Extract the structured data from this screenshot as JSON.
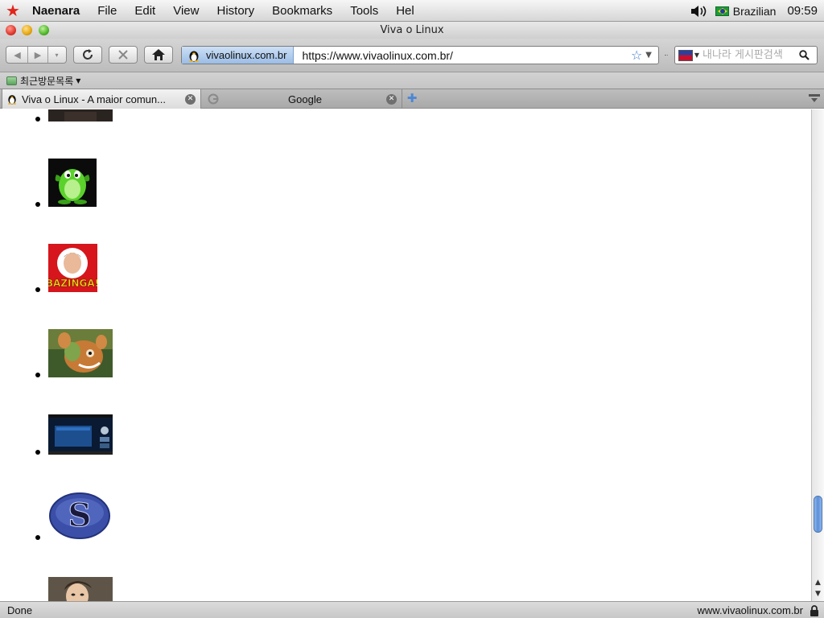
{
  "menubar": {
    "app_name": "Naenara",
    "items": [
      "File",
      "Edit",
      "View",
      "History",
      "Bookmarks",
      "Tools",
      "Hel"
    ],
    "input_language": "Brazilian",
    "clock": "09:59"
  },
  "window": {
    "title": "Viva o Linux"
  },
  "navbar": {
    "site_identity": "vivaolinux.com.br",
    "url": "https://www.vivaolinux.com.br/",
    "search_placeholder": "내나라 게시판검색"
  },
  "bookmarks": {
    "items": [
      {
        "label": "최근방문목록"
      }
    ]
  },
  "tabs": [
    {
      "label": "Viva o Linux - A maior comun...",
      "active": true
    },
    {
      "label": "Google",
      "active": false
    }
  ],
  "content": {
    "avatars": [
      {
        "icon": "dark-avatar"
      },
      {
        "icon": "green-tux-avatar"
      },
      {
        "icon": "bazinga-avatar",
        "text": "BAZINGA!"
      },
      {
        "icon": "cartoon-creature-avatar"
      },
      {
        "icon": "desktop-screenshot-avatar"
      },
      {
        "icon": "slackware-s-avatar",
        "text": "S"
      },
      {
        "icon": "person-avatar"
      }
    ]
  },
  "status": {
    "left": "Done",
    "right": "www.vivaolinux.com.br"
  },
  "colors": {
    "accent": "#3a78c8",
    "close_red": "#e0372c",
    "star_red": "#e0251b"
  }
}
